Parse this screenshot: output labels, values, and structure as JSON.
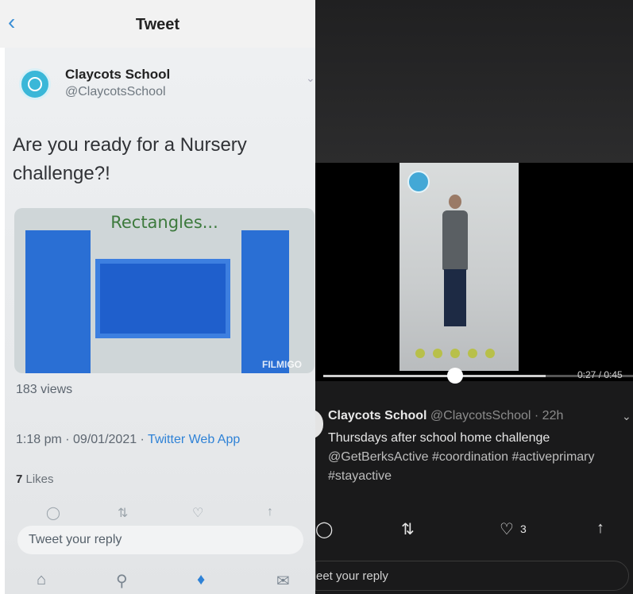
{
  "left": {
    "header": {
      "back_icon": "chevron-left-icon",
      "title": "Tweet"
    },
    "account": {
      "name": "Claycots School",
      "handle": "@ClaycotsSchool"
    },
    "tweet": {
      "text": "Are you ready for a Nursery challenge?!",
      "media_caption": "Rectangles...",
      "media_watermark": "FILMIGO",
      "views": "183 views",
      "time_date": "1:18 pm · 09/01/2021 · ",
      "source_app": "Twitter Web App",
      "likes_count": "7",
      "likes_label": " Likes"
    },
    "reply_placeholder": "Tweet your reply",
    "actions": [
      "reply-icon",
      "retweet-icon",
      "like-icon",
      "share-icon"
    ],
    "tabs": [
      "home-icon",
      "search-icon",
      "notifications-bell-icon",
      "messages-icon"
    ],
    "colors": {
      "accent": "#2f82d6",
      "text": "#303236",
      "secondary": "#5d6670"
    }
  },
  "right": {
    "video": {
      "time": "0:27 / 0:45",
      "progress": 0.55
    },
    "tweet": {
      "name": "Claycots School",
      "meta": " @ClaycotsSchool · 22h",
      "text": "Thursdays after school home challenge",
      "tags": "@GetBerksActive #coordination #activeprimary #stayactive",
      "likes_count": "3"
    },
    "reply_placeholder": "eet your reply",
    "colors": {
      "background": "#1a1a1b",
      "text": "#e6e6e6"
    }
  }
}
